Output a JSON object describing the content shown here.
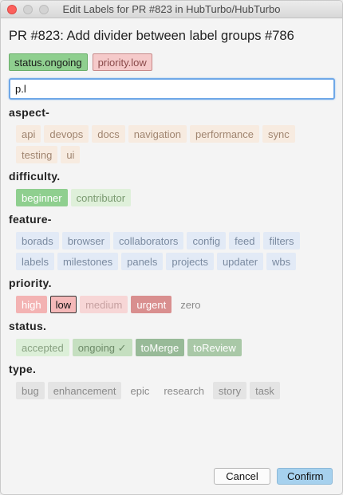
{
  "window": {
    "title": "Edit Labels for PR #823 in HubTurbo/HubTurbo"
  },
  "pr_title": "PR #823: Add divider between label groups #786",
  "selected_labels": [
    "status.ongoing",
    "priority.low"
  ],
  "search": {
    "value": "p.l"
  },
  "groups": {
    "aspect": {
      "name": "aspect-",
      "labels": [
        "api",
        "devops",
        "docs",
        "navigation",
        "performance",
        "sync",
        "testing",
        "ui"
      ]
    },
    "difficulty": {
      "name": "difficulty.",
      "labels": [
        "beginner",
        "contributor"
      ]
    },
    "feature": {
      "name": "feature-",
      "labels": [
        "borads",
        "browser",
        "collaborators",
        "config",
        "feed",
        "filters",
        "labels",
        "milestones",
        "panels",
        "projects",
        "updater",
        "wbs"
      ]
    },
    "priority": {
      "name": "priority.",
      "labels": [
        "high",
        "low",
        "medium",
        "urgent",
        "zero"
      ]
    },
    "status": {
      "name": "status.",
      "labels": [
        "accepted",
        "ongoing ✓",
        "toMerge",
        "toReview"
      ]
    },
    "type": {
      "name": "type.",
      "labels": [
        "bug",
        "enhancement",
        "epic",
        "research",
        "story",
        "task"
      ]
    }
  },
  "buttons": {
    "cancel": "Cancel",
    "confirm": "Confirm"
  },
  "colors": {
    "status_selected": "#8fcf8f",
    "priority_selected": "#f5caca",
    "confirm_button": "#a6d1ee",
    "search_focus": "#6fa8e8"
  }
}
